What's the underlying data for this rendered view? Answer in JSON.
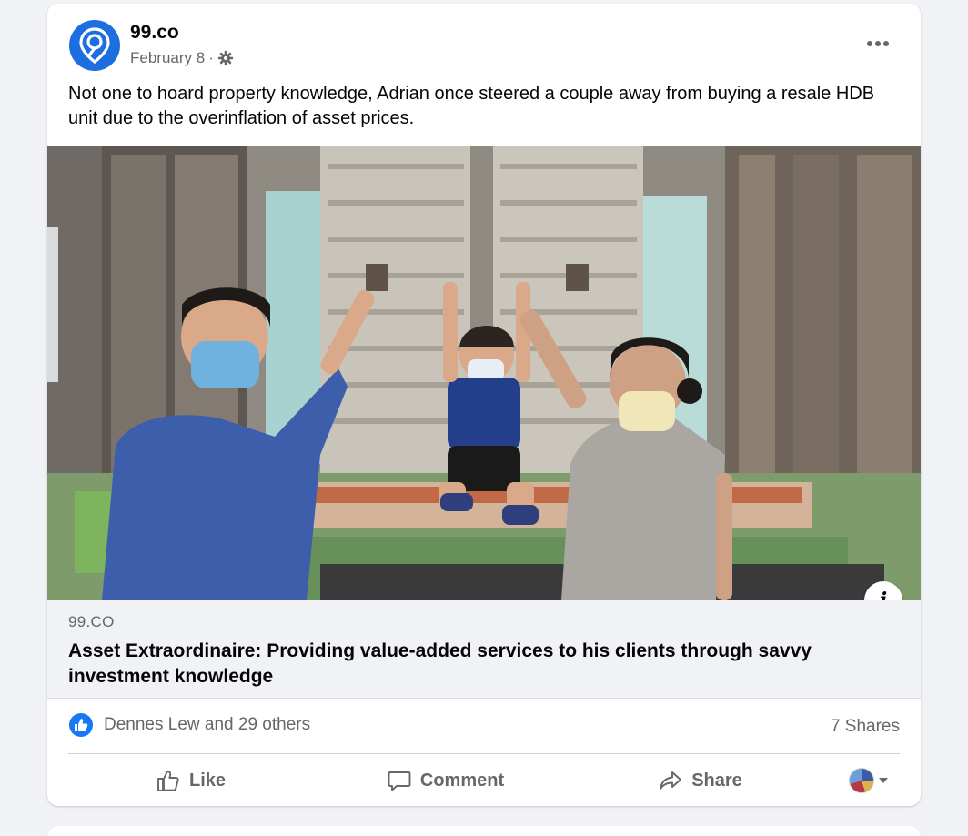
{
  "post": {
    "page_name": "99.co",
    "date": "February 8",
    "separator": "·",
    "privacy_icon": "gear-icon",
    "text": "Not one to hoard property knowledge, Adrian once steered a couple away from buying a resale HDB unit due to the overinflation of asset prices.",
    "more_icon": "more-horizontal-icon"
  },
  "link_preview": {
    "domain": "99.CO",
    "title": "Asset Extraordinaire: Providing value-added services to his clients through savvy investment knowledge",
    "info_label": "i"
  },
  "engagement": {
    "reactions_text": "Dennes Lew and 29 others",
    "shares_text": "7 Shares"
  },
  "actions": {
    "like_label": "Like",
    "comment_label": "Comment",
    "share_label": "Share"
  },
  "colors": {
    "brand_blue": "#1d6fe0",
    "like_blue": "#1877f2",
    "secondary_text": "#65676b",
    "background": "#f0f2f5"
  }
}
